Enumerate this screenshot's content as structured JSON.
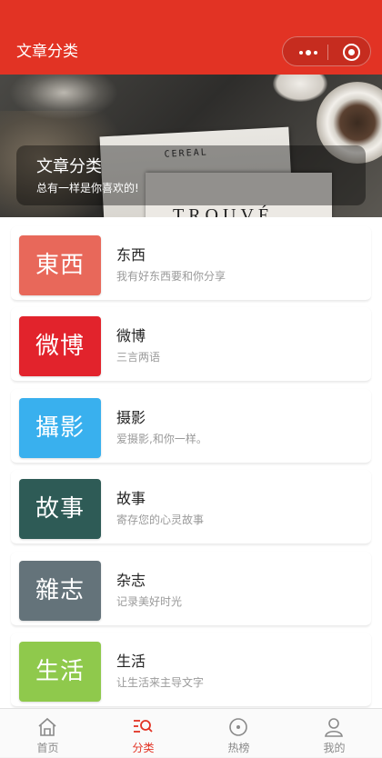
{
  "navbar": {
    "title": "文章分类"
  },
  "banner": {
    "title": "文章分类",
    "subtitle": "总有一样是你喜欢的!",
    "book_top_text": "CEREAL",
    "book_bottom_text": "TROUVÉ"
  },
  "categories": [
    {
      "tile": "東西",
      "title": "东西",
      "desc": "我有好东西要和你分享",
      "color": "#e8685a"
    },
    {
      "tile": "微博",
      "title": "微博",
      "desc": "三言两语",
      "color": "#e2232c"
    },
    {
      "tile": "攝影",
      "title": "摄影",
      "desc": "爱摄影,和你一样。",
      "color": "#39b0ee"
    },
    {
      "tile": "故事",
      "title": "故事",
      "desc": "寄存您的心灵故事",
      "color": "#2e5b56"
    },
    {
      "tile": "雜志",
      "title": "杂志",
      "desc": "记录美好时光",
      "color": "#64737a"
    },
    {
      "tile": "生活",
      "title": "生活",
      "desc": "让生活来主导文字",
      "color": "#8fc94c"
    }
  ],
  "tabbar": {
    "items": [
      {
        "label": "首页",
        "icon": "home-icon",
        "active": false
      },
      {
        "label": "分类",
        "icon": "category-search-icon",
        "active": true
      },
      {
        "label": "热榜",
        "icon": "hot-circle-icon",
        "active": false
      },
      {
        "label": "我的",
        "icon": "user-icon",
        "active": false
      }
    ],
    "active_color": "#e23324",
    "inactive_color": "#8a8a8a"
  },
  "colors": {
    "brand": "#e23324"
  }
}
